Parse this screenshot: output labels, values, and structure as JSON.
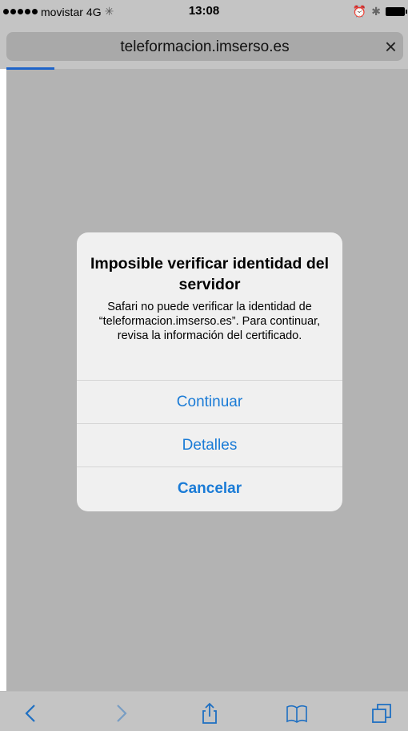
{
  "status_bar": {
    "carrier": "movistar",
    "network": "4G",
    "time": "13:08"
  },
  "address_bar": {
    "url": "teleformacion.imserso.es",
    "close_label": "×"
  },
  "dialog": {
    "title": "Imposible verificar identidad del servidor",
    "message": "Safari no puede verificar la identidad de “teleformacion.imserso.es”. Para continuar, revisa la información del certificado.",
    "buttons": {
      "continue": "Continuar",
      "details": "Detalles",
      "cancel": "Cancelar"
    }
  },
  "toolbar": {
    "icons": [
      "back-icon",
      "forward-icon",
      "share-icon",
      "bookmarks-icon",
      "tabs-icon"
    ]
  },
  "colors": {
    "accent": "#1a7bd6",
    "overlay": "#b3b3b3"
  }
}
